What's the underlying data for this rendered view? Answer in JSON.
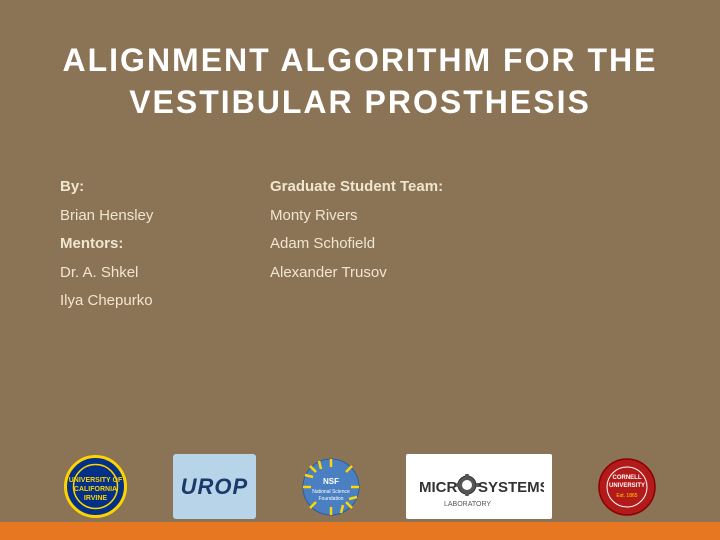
{
  "slide": {
    "title": "ALIGNMENT ALGORITHM FOR THE VESTIBULAR PROSTHESIS",
    "left_col": {
      "by_label": "By:",
      "author": "Brian Hensley",
      "mentors_label": "Mentors:",
      "mentor1": "Dr. A. Shkel",
      "mentor2": "Ilya Chepurko"
    },
    "right_col": {
      "team_label": "Graduate Student Team:",
      "member1": "Monty Rivers",
      "member2": "Adam Schofield",
      "member3": "Alexander Trusov"
    },
    "logos": [
      {
        "name": "UCI",
        "type": "uci"
      },
      {
        "name": "UROP",
        "type": "urop"
      },
      {
        "name": "NSF",
        "type": "nsf"
      },
      {
        "name": "MicroSystems",
        "type": "microsystems"
      },
      {
        "name": "Cornell",
        "type": "cornell"
      }
    ]
  }
}
